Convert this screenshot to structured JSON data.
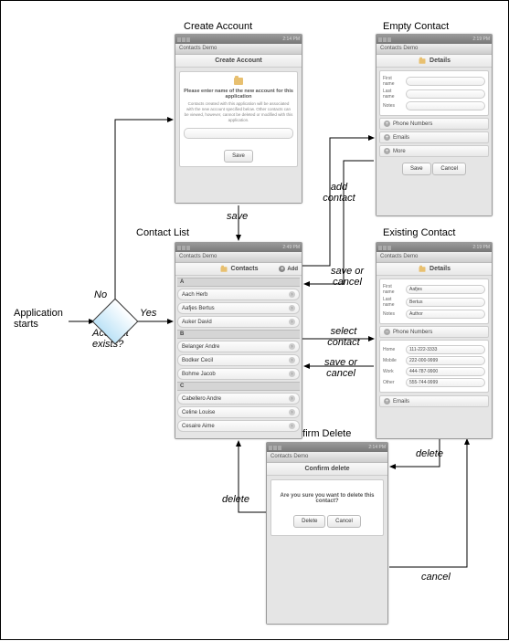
{
  "titles": {
    "create_account": "Create Account",
    "empty_contact": "Empty Contact",
    "contact_list": "Contact List",
    "existing_contact": "Existing Contact",
    "confirm_delete": "Confirm Delete"
  },
  "flow": {
    "app_starts": "Application starts",
    "account_exists": "Account exists?",
    "no": "No",
    "yes": "Yes",
    "save": "save",
    "add_contact": "add contact",
    "save_or_cancel": "save or cancel",
    "select_contact": "select contact",
    "delete": "delete",
    "cancel": "cancel"
  },
  "statusbar": {
    "time1": "2:14 PM",
    "time2": "2:49 PM",
    "time3": "2:19 PM"
  },
  "app_title": "Contacts Demo",
  "create_account_screen": {
    "header": "Create Account",
    "prompt_bold": "Please enter name of the new account for this application",
    "prompt_desc": "Contacts created with this application will be associated with the new account specified below. Other contacts can be viewed, however, cannot be deleted or modified with this application.",
    "save_btn": "Save"
  },
  "contact_list_screen": {
    "header": "Contacts",
    "add": "Add",
    "sections": {
      "A": [
        "Aach Herb",
        "Aafjes Bertus",
        "Auker David"
      ],
      "B": [
        "Belanger Andre",
        "Bodker Cecil",
        "Bohme Jacob"
      ],
      "C": [
        "Cabellero Andre",
        "Celine Louise",
        "Cesaire Aime"
      ]
    }
  },
  "details_screen": {
    "header": "Details",
    "first_name_lbl": "First name",
    "last_name_lbl": "Last name",
    "notes_lbl": "Notes",
    "phone_numbers_lbl": "Phone Numbers",
    "emails_lbl": "Emails",
    "more_lbl": "More",
    "save_btn": "Save",
    "cancel_btn": "Cancel"
  },
  "existing_contact_screen": {
    "first_name": "Aafjes",
    "last_name": "Bertus",
    "notes": "Author",
    "phones": [
      {
        "type": "Home",
        "number": "111-222-3333"
      },
      {
        "type": "Mobile",
        "number": "222-000-9999"
      },
      {
        "type": "Work",
        "number": "444-787-9900"
      },
      {
        "type": "Other",
        "number": "555-744-9999"
      }
    ]
  },
  "confirm_delete_screen": {
    "header": "Confirm delete",
    "message": "Are you sure you want to delete this contact?",
    "delete_btn": "Delete",
    "cancel_btn": "Cancel"
  }
}
